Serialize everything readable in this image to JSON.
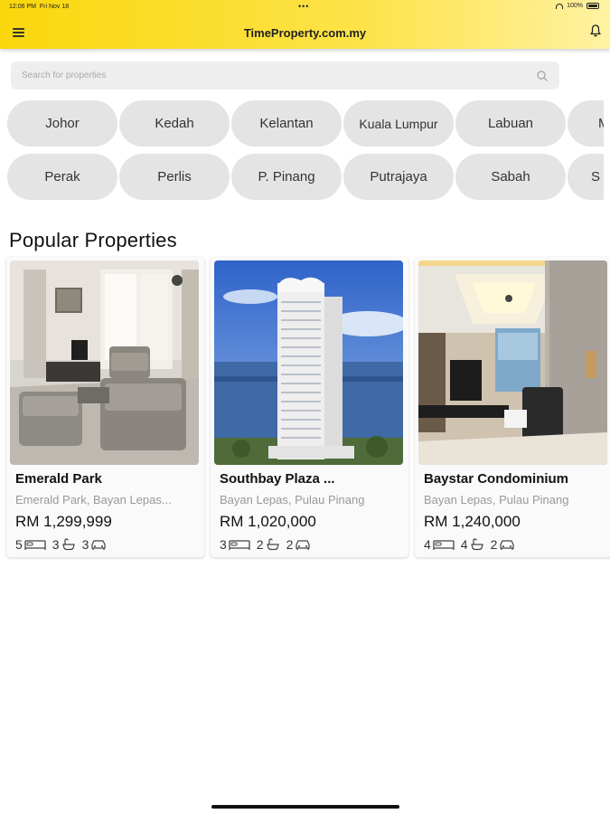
{
  "status": {
    "time": "12:06 PM",
    "date": "Fri Nov 18",
    "battery": "100%"
  },
  "header": {
    "title": "TimeProperty.com.my"
  },
  "search": {
    "placeholder": "Search for properties"
  },
  "regions": {
    "row1": [
      "Johor",
      "Kedah",
      "Kelantan",
      "Kuala Lumpur",
      "Labuan",
      "M"
    ],
    "row2": [
      "Perak",
      "Perlis",
      "P. Pinang",
      "Putrajaya",
      "Sabah",
      "S"
    ]
  },
  "section": {
    "title": "Popular Properties"
  },
  "properties": [
    {
      "name": "Emerald Park",
      "location": "Emerald Park, Bayan Lepas...",
      "price": "RM 1,299,999",
      "bedrooms": "5",
      "bathrooms": "3",
      "parking": "3",
      "image": "living-room-photo"
    },
    {
      "name": "Southbay Plaza ...",
      "location": "Bayan Lepas, Pulau Pinang",
      "price": "RM 1,020,000",
      "bedrooms": "3",
      "bathrooms": "2",
      "parking": "2",
      "image": "condo-tower-photo"
    },
    {
      "name": "Baystar Condominium",
      "location": "Bayan Lepas, Pulau Pinang",
      "price": "RM 1,240,000",
      "bedrooms": "4",
      "bathrooms": "4",
      "parking": "2",
      "image": "modern-living-room-photo"
    }
  ],
  "colors": {
    "header": "#f9d70c",
    "chip": "#e4e4e4",
    "search_bg": "#eeeeee"
  }
}
